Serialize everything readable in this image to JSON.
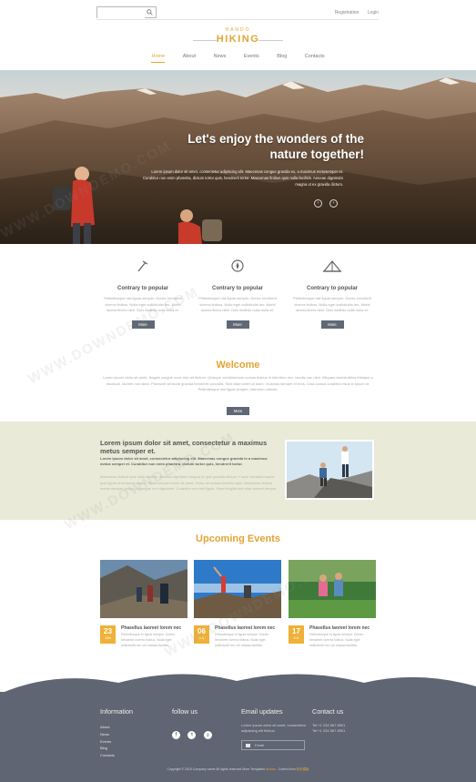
{
  "header": {
    "search": {
      "value": "",
      "placeholder": ""
    },
    "links": [
      "Registration",
      "Login"
    ],
    "logo_small": "HANDO",
    "logo_main": "HIKING",
    "nav": [
      {
        "label": "Home",
        "active": true
      },
      {
        "label": "About",
        "active": false
      },
      {
        "label": "News",
        "active": false
      },
      {
        "label": "Events",
        "active": false
      },
      {
        "label": "Blog",
        "active": false
      },
      {
        "label": "Contacts",
        "active": false
      }
    ]
  },
  "hero": {
    "title_line1": "Let's enjoy the wonders of the",
    "title_line2": "nature together!",
    "text": "Lorem ipsum dolor sit amet, consectetur adipiscing elit. Maecenas congue gravida ex, a maximus metusemper et. Curabitur non enim pharetra, dictum tortor quis, hendrerit tortor. Maecenas finibus quis nulla facilisis. Aenean dignissim magna ut ex gravida dictum.",
    "prev": "‹",
    "next": "›"
  },
  "features": [
    {
      "icon": "trekking-pole-icon",
      "title": "Contrary to popular",
      "text": "Pellentesque nisi ligula semper. Donec hendrerit viverra finibus. Nulla eget sollicitudin leo. Morbi lacinia libero nibh. Duis facilisis nulla nulla et.",
      "button": "More"
    },
    {
      "icon": "compass-icon",
      "title": "Contrary to popular",
      "text": "Pellentesque nisi ligula semper. Donec hendrerit viverra finibus. Nulla eget sollicitudin leo. Morbi lacinia libero nibh. Duis facilisis nulla nulla et.",
      "button": "More"
    },
    {
      "icon": "tent-icon",
      "title": "Contrary to popular",
      "text": "Pellentesque nisi ligula semper. Donec hendrerit viverra finibus. Nulla eget sollicitudin leo. Morbi lacinia libero nibh. Duis facilisis nulla nulla et.",
      "button": "More"
    }
  ],
  "welcome": {
    "title": "Welcome",
    "text": "Lorem ipsum dolor sit amet, feugiat congue nunc nisi vel dictum. Quisque condimentum cursus finibus in interdum nec, iaculis non nibh. Aliquam lacinia tellus tristique a tincidunt, laoreet non diam. Praesent vehicula gravida hendrerit convallis. Sed vitae lorem id diam. Vivamus semper et eros. Cras cursus curabitur risus in ipsum id. Pellentesque nisi ligula semper, interdum ultrices.",
    "button": "More"
  },
  "about": {
    "title": "Lorem ipsum dolor sit amet, consectetur a maximus metus semper et.",
    "lead": "Lorem ipsum dolor sit amet, consectetur adipiscing elit. Maecenas congue gravida in a maximus metus semper et. Curabitur non enim pharetra, dictum tortor quis, hendrerit tortor.",
    "text": "Maecenas finibus quis nulla facilisis. Aenean dignissim magna ut quis gravida dictum. Fusce volutpat mauris quis ligula et tincidunt augue. Nulla semper lorem sit amet. Nulla vel massa facilisis eget. Maecenas finibus metus semper purus, in congue orci dignissim. Curabitur non nisl ligula. Nam fringilla nisl vitae laoreet tempor."
  },
  "events": {
    "title": "Upcoming Events",
    "items": [
      {
        "day": "23",
        "month": "JUN",
        "title": "Phasellus laoreet lorem nec",
        "text": "Pellentesque et ligula semper. Donec hendrerit viverra finibus. Nulla eget sollicitudin leo vel massa facilisis."
      },
      {
        "day": "06",
        "month": "JUL",
        "title": "Phasellus laoreet lorem nec",
        "text": "Pellentesque et ligula semper. Donec hendrerit viverra finibus. Nulla eget sollicitudin leo vel massa facilisis."
      },
      {
        "day": "17",
        "month": "JUL",
        "title": "Phasellus laoreet lorem nec",
        "text": "Pellentesque et ligula semper. Donec hendrerit viverra finibus. Nulla eget sollicitudin leo vel massa facilisis."
      }
    ]
  },
  "footer": {
    "information": {
      "heading": "Information",
      "links": [
        "About",
        "News",
        "Events",
        "Blog",
        "Contacts"
      ]
    },
    "follow": {
      "heading": "follow us",
      "icons": [
        "f",
        "t",
        "rss"
      ]
    },
    "email": {
      "heading": "Email updates",
      "text": "Lorem ipsum dolor sit amet, consectetur adipiscing elit finibus.",
      "placeholder": "Email"
    },
    "contact": {
      "heading": "Contact us",
      "lines": [
        "Tel:+1 234 567 8901",
        "Tel:+1 234 567 8901"
      ]
    },
    "copyright_pre": "Copyright © 2015 Company name All rights reserved More Templates",
    "copyright_link1": "Moban",
    "copyright_mid": " - Collect from",
    "copyright_link2": "网页模板"
  },
  "watermark": "WWW.DOWNDEMO.COM",
  "colors": {
    "accent": "#e5a334",
    "button": "#606875",
    "band": "#e9ead8",
    "footer": "#5f6572"
  }
}
